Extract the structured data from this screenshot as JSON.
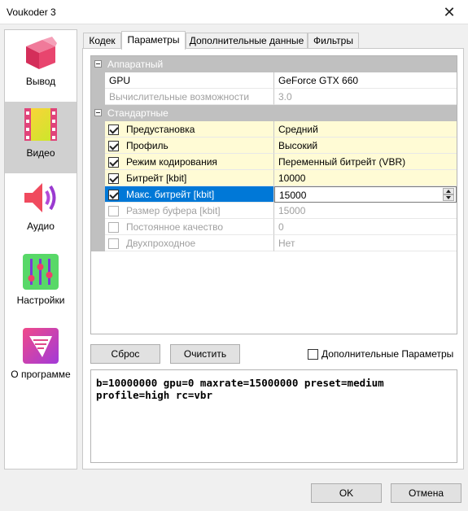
{
  "window": {
    "title": "Voukoder 3",
    "close_glyph": "✕"
  },
  "sidebar": {
    "items": [
      {
        "label": "Вывод",
        "icon": "output-cube-icon"
      },
      {
        "label": "Видео",
        "icon": "video-film-icon"
      },
      {
        "label": "Аудио",
        "icon": "audio-speaker-icon"
      },
      {
        "label": "Настройки",
        "icon": "settings-sliders-icon"
      },
      {
        "label": "О программе",
        "icon": "about-funnel-icon"
      }
    ]
  },
  "tabs": [
    {
      "label": "Кодек"
    },
    {
      "label": "Параметры"
    },
    {
      "label": "Дополнительные данные"
    },
    {
      "label": "Фильтры"
    }
  ],
  "properties": {
    "cat_hardware": "Аппаратный",
    "gpu": {
      "name": "GPU",
      "value": "GeForce GTX 660"
    },
    "compute": {
      "name": "Вычислительные возможности",
      "value": "3.0"
    },
    "cat_standard": "Стандартные",
    "preset": {
      "name": "Предустановка",
      "value": "Средний",
      "checked": true
    },
    "profile": {
      "name": "Профиль",
      "value": "Высокий",
      "checked": true
    },
    "rc": {
      "name": "Режим кодирования",
      "value": "Переменный битрейт (VBR)",
      "checked": true
    },
    "bitrate": {
      "name": "Битрейт [kbit]",
      "value": "10000",
      "checked": true
    },
    "maxrate": {
      "name": "Макс. битрейт [kbit]",
      "value": "15000",
      "checked": true
    },
    "bufsize": {
      "name": "Размер буфера [kbit]",
      "value": "15000",
      "checked": false
    },
    "cq": {
      "name": "Постоянное качество",
      "value": "0",
      "checked": false
    },
    "twopass": {
      "name": "Двухпроходное",
      "value": "Нет",
      "checked": false
    }
  },
  "buttons": {
    "reset": "Сброс",
    "clear": "Очистить",
    "advanced": "Дополнительные Параметры",
    "ok": "OK",
    "cancel": "Отмена"
  },
  "output": {
    "params": "b=10000000 gpu=0 maxrate=15000000 preset=medium\nprofile=high rc=vbr"
  },
  "colors": {
    "selection": "#0078d7",
    "highlight_row": "#fffbd5",
    "category": "#c0c0c0"
  }
}
